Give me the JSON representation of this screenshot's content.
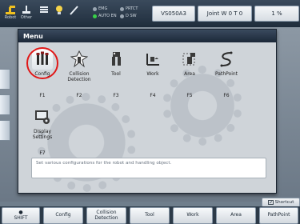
{
  "topbar": {
    "icons": [
      {
        "name": "robot-icon",
        "sub": "Robot"
      },
      {
        "name": "tool-icon",
        "sub": "Other"
      },
      {
        "name": "program-icon",
        "sub": ""
      },
      {
        "name": "lightbulb-icon",
        "sub": ""
      },
      {
        "name": "pen-icon",
        "sub": ""
      }
    ],
    "status": {
      "emg": "EMG",
      "protect": "PRTCT",
      "auto_en": "AUTO EN",
      "dsw": "D SW"
    },
    "program_name": "VS050A3",
    "coordinate_mode": "Joint W 0 T 0",
    "speed": "1 %"
  },
  "menu": {
    "title": "Menu",
    "items": [
      {
        "label": "Config",
        "key": "F1",
        "icon": "config-icon"
      },
      {
        "label": "Collision Detection",
        "key": "F2",
        "icon": "collision-detection-icon"
      },
      {
        "label": "Tool",
        "key": "F3",
        "icon": "tool-icon"
      },
      {
        "label": "Work",
        "key": "F4",
        "icon": "work-icon"
      },
      {
        "label": "Area",
        "key": "F5",
        "icon": "area-icon"
      },
      {
        "label": "PathPoint",
        "key": "F6",
        "icon": "pathpoint-icon"
      },
      {
        "label": "Display Settings",
        "key": "F7",
        "icon": "display-settings-icon"
      }
    ],
    "description": "Set various configurations for the robot and handling object."
  },
  "shortcut_label": "Shortcut",
  "function_keys": [
    {
      "label": "SHIFT"
    },
    {
      "label": "Config"
    },
    {
      "label": "Collision Detection"
    },
    {
      "label": "Tool"
    },
    {
      "label": "Work"
    },
    {
      "label": "Area"
    },
    {
      "label": "PathPoint"
    }
  ],
  "colors": {
    "highlight_ring": "#e01818",
    "title_bar": "#1c2838",
    "menu_bg": "#cfd4d9"
  }
}
